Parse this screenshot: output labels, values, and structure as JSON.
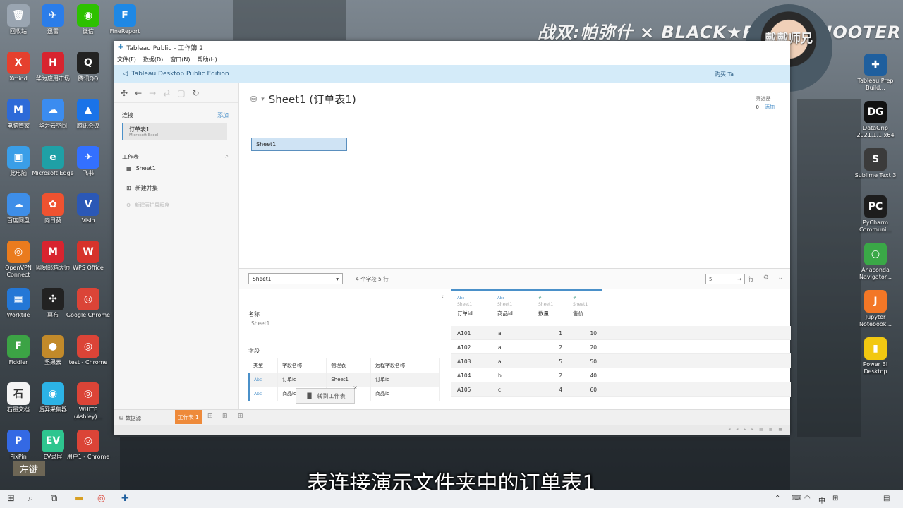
{
  "banner": "战双:帕弥什 × BLACK★ROCK SHOOTER",
  "webcam_name": "戴戴师兄",
  "desktop_left": [
    {
      "label": "回收站",
      "color": "#9aa5b1",
      "glyph": "🗑"
    },
    {
      "label": "迅雷",
      "color": "#2b7de9",
      "glyph": "✈"
    },
    {
      "label": "微信",
      "color": "#2dc100",
      "glyph": "◉"
    },
    {
      "label": "FineReport",
      "color": "#1e88e5",
      "glyph": "F"
    },
    {
      "label": "Xmind",
      "color": "#e5402e",
      "glyph": "X"
    },
    {
      "label": "华为应用市场",
      "color": "#d8242f",
      "glyph": "H"
    },
    {
      "label": "腾讯QQ",
      "color": "#222222",
      "glyph": "Q"
    },
    {
      "label": "电脑管家",
      "color": "#2d6ad8",
      "glyph": "M"
    },
    {
      "label": "华为云空间",
      "color": "#3b8cf0",
      "glyph": "☁"
    },
    {
      "label": "腾讯会议",
      "color": "#1a73e8",
      "glyph": "▲"
    },
    {
      "label": "此电脑",
      "color": "#3a9ee8",
      "glyph": "▣"
    },
    {
      "label": "Microsoft Edge",
      "color": "#1fa0a6",
      "glyph": "e"
    },
    {
      "label": "飞书",
      "color": "#3370ff",
      "glyph": "✈"
    },
    {
      "label": "百度网盘",
      "color": "#3e8ee8",
      "glyph": "☁"
    },
    {
      "label": "向日葵",
      "color": "#ef5230",
      "glyph": "✿"
    },
    {
      "label": "Visio",
      "color": "#2b58b6",
      "glyph": "V"
    },
    {
      "label": "OpenVPN Connect",
      "color": "#ea7b1d",
      "glyph": "◎"
    },
    {
      "label": "网易邮箱大师",
      "color": "#d8242f",
      "glyph": "M"
    },
    {
      "label": "WPS Office",
      "color": "#d6332b",
      "glyph": "W"
    },
    {
      "label": "Worktile",
      "color": "#2477d6",
      "glyph": "▦"
    },
    {
      "label": "幕布",
      "color": "#222222",
      "glyph": "✣"
    },
    {
      "label": "Google Chrome",
      "color": "#db4437",
      "glyph": "◎"
    },
    {
      "label": "Fiddler",
      "color": "#3ca345",
      "glyph": "F"
    },
    {
      "label": "坚果云",
      "color": "#c28a2a",
      "glyph": "●"
    },
    {
      "label": "test - Chrome",
      "color": "#db4437",
      "glyph": "◎"
    },
    {
      "label": "石墨文档",
      "color": "#f4f4f4",
      "glyph": "石"
    },
    {
      "label": "后羿采集器",
      "color": "#2cb3e6",
      "glyph": "◉"
    },
    {
      "label": "WHITE (Ashley)...",
      "color": "#db4437",
      "glyph": "◎"
    },
    {
      "label": "PixPin",
      "color": "#3469e4",
      "glyph": "P"
    },
    {
      "label": "EV录屏",
      "color": "#2ec58f",
      "glyph": "EV"
    },
    {
      "label": "用户1 - Chrome",
      "color": "#db4437",
      "glyph": "◎"
    }
  ],
  "desktop_right": [
    {
      "label": "Tableau Prep Build...",
      "color": "#1f5f9e",
      "glyph": "✚"
    },
    {
      "label": "DataGrip 2021.1.1 x64",
      "color": "#111111",
      "glyph": "DG"
    },
    {
      "label": "Sublime Text 3",
      "color": "#3b3b3b",
      "glyph": "S"
    },
    {
      "label": "PyCharm Communi...",
      "color": "#1d1d1d",
      "glyph": "PC"
    },
    {
      "label": "Anaconda Navigator...",
      "color": "#3aa847",
      "glyph": "○"
    },
    {
      "label": "Jupyter Notebook...",
      "color": "#f37726",
      "glyph": "J"
    },
    {
      "label": "Power BI Desktop",
      "color": "#f2c811",
      "glyph": "▮"
    }
  ],
  "window": {
    "title": "Tableau Public - 工作簿 2",
    "menu": [
      "文件(F)",
      "数据(D)",
      "窗口(N)",
      "帮助(H)"
    ],
    "edition": "Tableau Desktop Public Edition",
    "buy": "购买 Ta"
  },
  "left_pane": {
    "connections_label": "连接",
    "add_label": "添加",
    "connection_name": "订单表1",
    "connection_type": "Microsoft Excel",
    "sheets_label": "工作表",
    "sheet_item": "Sheet1",
    "new_union": "新建并集",
    "new_extension": "新建表扩展程序"
  },
  "canvas": {
    "title": "Sheet1 (订单表1)",
    "filters_label": "筛选器",
    "filters_count": "0",
    "filters_add": "添加",
    "sheet_box": "Sheet1"
  },
  "grid_bar": {
    "selected_table": "Sheet1",
    "meta": "4 个字段 5 行",
    "rows_value": "5",
    "rows_label": "行"
  },
  "meta_pane": {
    "name_label": "名称",
    "name_value": "Sheet1",
    "fields_label": "字段",
    "headers": [
      "类型",
      "字段名称",
      "物理表",
      "远程字段名称"
    ],
    "rows": [
      {
        "type": "Abc",
        "field": "订单id",
        "table": "Sheet1",
        "remote": "订单id"
      },
      {
        "type": "Abc",
        "field": "商品id",
        "table": "Sheet1",
        "remote": "商品id"
      }
    ],
    "goto_worksheet": "转到工作表"
  },
  "data_grid": {
    "columns": [
      {
        "type": "Abc",
        "source": "Sheet1",
        "name": "订单id"
      },
      {
        "type": "Abc",
        "source": "Sheet1",
        "name": "商品id"
      },
      {
        "type": "#",
        "source": "Sheet1",
        "name": "数量"
      },
      {
        "type": "#",
        "source": "Sheet1",
        "name": "售价"
      }
    ],
    "rows": [
      [
        "A101",
        "a",
        "1",
        "10"
      ],
      [
        "A102",
        "a",
        "2",
        "20"
      ],
      [
        "A103",
        "a",
        "5",
        "50"
      ],
      [
        "A104",
        "b",
        "2",
        "40"
      ],
      [
        "A105",
        "c",
        "4",
        "60"
      ]
    ]
  },
  "status_bar": {
    "datasource": "数据源",
    "worksheet_tab": "工作表 1"
  },
  "subtitle": "表连接演示文件夹中的订单表1",
  "left_key": "左键",
  "taskbar": {
    "ime_lang": "中"
  }
}
